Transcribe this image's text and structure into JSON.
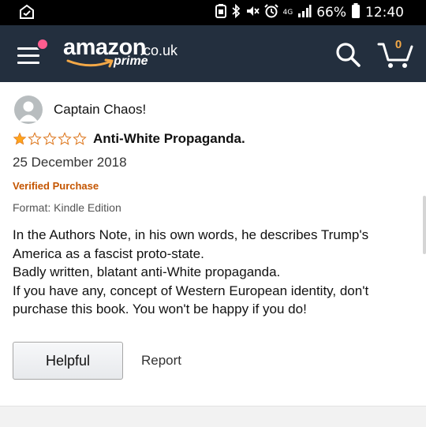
{
  "status_bar": {
    "battery_percent": "66%",
    "time": "12:40",
    "network": "4G",
    "icons": [
      "notification-icon",
      "battery-saver-icon",
      "bluetooth-icon",
      "mute-icon",
      "alarm-icon",
      "signal-icon",
      "battery-icon"
    ]
  },
  "header": {
    "logo_word": "amazon",
    "logo_tld": ".co.uk",
    "logo_prime": "prime",
    "cart_count": "0",
    "colors": {
      "background": "#232f3e",
      "cart_accent": "#f3a847",
      "notification_dot": "#ff5d8f"
    }
  },
  "review": {
    "reviewer_name": "Captain Chaos!",
    "rating": 1,
    "rating_max": 5,
    "title": "Anti-White Propaganda.",
    "date": "25 December 2018",
    "verified_label": "Verified Purchase",
    "format_label": "Format: Kindle Edition",
    "body_lines": [
      "In the Authors Note, in his own words, he describes Trump's",
      "America as a fascist proto-state.",
      "Badly written, blatant anti-White propaganda.",
      "If you have any, concept of Western European identity, don't",
      "purchase this book. You won't be happy if you do!"
    ],
    "colors": {
      "star": "#ffa41c",
      "verified": "#c45500"
    }
  },
  "actions": {
    "helpful_label": "Helpful",
    "report_label": "Report"
  }
}
